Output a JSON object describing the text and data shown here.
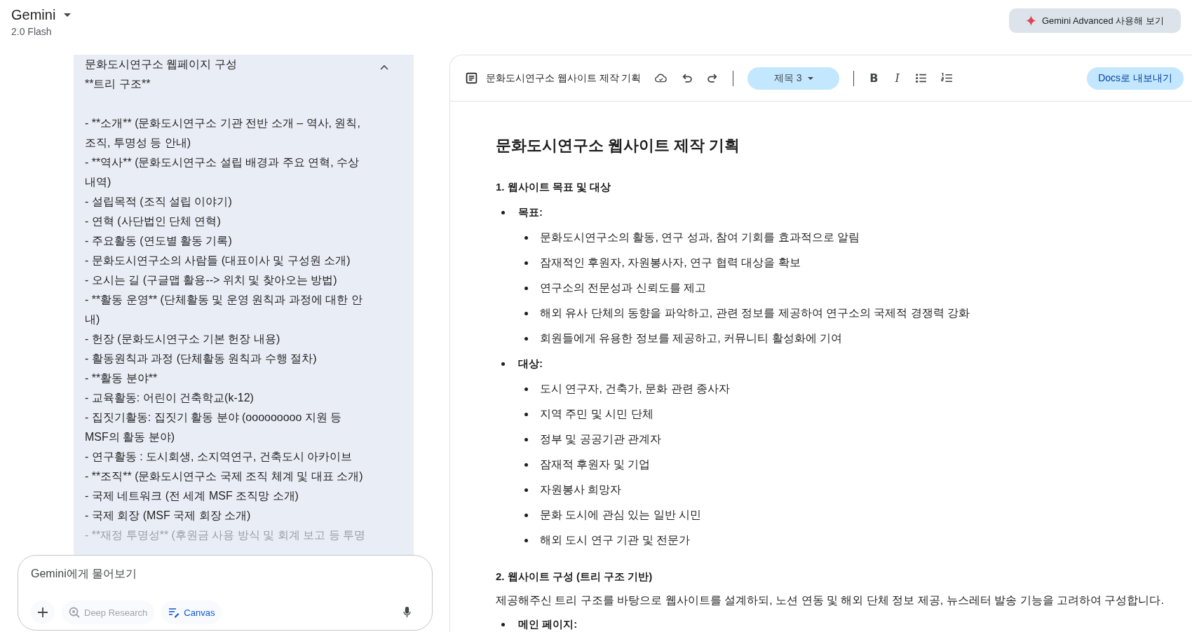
{
  "header": {
    "title": "Gemini",
    "model": "2.0 Flash",
    "upgrade_button": "Gemini Advanced 사용해 보기"
  },
  "chat": {
    "expanded": true,
    "heading_lines": [
      "문화도시연구소 웹페이지 구성",
      "**트리 구조**"
    ],
    "lines": [
      "- **소개** (문화도시연구소 기관 전반 소개 – 역사, 원칙, 조직, 투명성 등 안내)",
      "- **역사** (문화도시연구소 설립 배경과 주요 연혁, 수상 내역)",
      "- 설립목적 (조직 설립 이야기)",
      "- 연혁 (사단법인 단체 연혁)",
      "- 주요활동 (연도별 활동 기록)",
      "- 문화도시연구소의 사람들 (대표이사 및 구성원 소개)",
      "- 오시는 길 (구글맵 활용--> 위치 및 찾아오는 방법)",
      "- **활동 운영** (단체활동 및 운영 원칙과 과정에 대한 안내)",
      "- 헌장 (문화도시연구소 기본 헌장 내용)",
      "- 활동원칙과 과정 (단체활동 원칙과 수행 절차)",
      "- **활동 분야**",
      "- 교육활동: 어린이 건축학교(k-12)",
      "- 집짓기활동: 집짓기 활동 분야 (ooooooooo 지원 등 MSF의 활동 분야)",
      "- 연구활동 : 도시회생, 소지역연구, 건축도시 아카이브",
      "- **조직** (문화도시연구소 국제 조직 체계 및 대표 소개)",
      "- 국제 네트워크 (전 세계 MSF 조직망 소개)",
      "- 국제 회장 (MSF 국제 회장 소개)",
      "- **재정 투명성** (후원금 사용 방식 및 회계 보고 등 투명"
    ]
  },
  "prompt": {
    "placeholder": "Gemini에게 물어보기",
    "tools": [
      {
        "kind": "research",
        "label": "Deep Research",
        "selected": false
      },
      {
        "kind": "canvas",
        "label": "Canvas",
        "selected": true
      }
    ]
  },
  "canvas": {
    "doc_title": "문화도시연구소 웹사이트 제작 기획",
    "style_dropdown": "제목 3",
    "format_buttons": [
      {
        "kind": "bold",
        "label": "B"
      },
      {
        "kind": "italic",
        "label": "I"
      }
    ],
    "export_button": "Docs로 내보내기",
    "content": [
      {
        "kind": "title",
        "text": "문화도시연구소 웹사이트 제작 기획"
      },
      {
        "kind": "heading",
        "text": "1. 웹사이트 목표 및 대상"
      },
      {
        "kind": "bullet",
        "text": "목표:",
        "children": [
          {
            "text": "문화도시연구소의 활동, 연구 성과, 참여 기회를 효과적으로 알림"
          },
          {
            "text": "잠재적인 후원자, 자원봉사자, 연구 협력 대상을 확보"
          },
          {
            "text": "연구소의 전문성과 신뢰도를 제고"
          },
          {
            "text": "해외 유사 단체의 동향을 파악하고, 관련 정보를 제공하여 연구소의 국제적 경쟁력 강화"
          },
          {
            "text": "회원들에게 유용한 정보를 제공하고, 커뮤니티 활성화에 기여"
          }
        ]
      },
      {
        "kind": "bullet",
        "text": "대상:",
        "children": [
          {
            "text": "도시 연구자, 건축가, 문화 관련 종사자"
          },
          {
            "text": "지역 주민 및 시민 단체"
          },
          {
            "text": "정부 및 공공기관 관계자"
          },
          {
            "text": "잠재적 후원자 및 기업"
          },
          {
            "text": "자원봉사 희망자"
          },
          {
            "text": "문화 도시에 관심 있는 일반 시민"
          },
          {
            "text": "해외 도시 연구 기관 및 전문가"
          }
        ]
      },
      {
        "kind": "heading",
        "text": "2. 웹사이트 구성 (트리 구조 기반)"
      },
      {
        "kind": "paragraph",
        "text": "제공해주신 트리 구조를 바탕으로 웹사이트를 설계하되, 노션 연동 및 해외 단체 정보 제공, 뉴스레터 발송 기능을 고려하여 구성합니다."
      },
      {
        "kind": "bullet",
        "text": "메인 페이지:"
      }
    ]
  }
}
